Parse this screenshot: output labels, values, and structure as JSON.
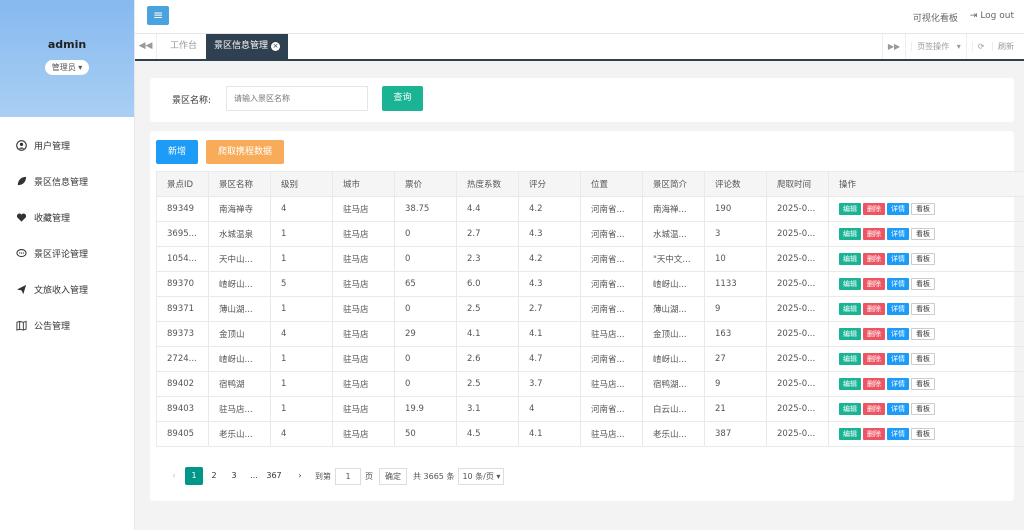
{
  "sidebar": {
    "username": "admin",
    "role": "管理员",
    "items": [
      {
        "icon": "user-icon",
        "label": "用户管理"
      },
      {
        "icon": "leaf-icon",
        "label": "景区信息管理"
      },
      {
        "icon": "heart-icon",
        "label": "收藏管理"
      },
      {
        "icon": "comment-icon",
        "label": "景区评论管理"
      },
      {
        "icon": "paper-plane-icon",
        "label": "文旅收入管理"
      },
      {
        "icon": "map-icon",
        "label": "公告管理"
      }
    ]
  },
  "topbar": {
    "dashboard_link": "可视化看板",
    "logout": "Log out"
  },
  "tabs": {
    "items": [
      {
        "label": "工作台"
      },
      {
        "label": "景区信息管理"
      }
    ],
    "page_ops": "页签操作",
    "refresh": "刷新"
  },
  "search": {
    "label": "景区名称:",
    "placeholder": "请输入景区名称",
    "button": "查询"
  },
  "actions": {
    "add": "新增",
    "crawl": "爬取携程数据"
  },
  "table": {
    "headers": [
      "景点ID",
      "景区名称",
      "级别",
      "城市",
      "票价",
      "热度系数",
      "评分",
      "位置",
      "景区简介",
      "评论数",
      "爬取时间",
      "操作"
    ],
    "op_labels": {
      "edit": "编辑",
      "del": "删除",
      "detail": "详情",
      "board": "看板"
    },
    "rows": [
      [
        "89349",
        "南海禅寺",
        "4",
        "驻马店",
        "38.75",
        "4.4",
        "4.2",
        "河南省...",
        "南海禅...",
        "190",
        "2025-0..."
      ],
      [
        "3695...",
        "水城温泉",
        "1",
        "驻马店",
        "0",
        "2.7",
        "4.3",
        "河南省...",
        "水城温...",
        "3",
        "2025-0..."
      ],
      [
        "1054...",
        "天中山...",
        "1",
        "驻马店",
        "0",
        "2.3",
        "4.2",
        "河南省...",
        "\"天中文...",
        "10",
        "2025-0..."
      ],
      [
        "89370",
        "嵖岈山...",
        "5",
        "驻马店",
        "65",
        "6.0",
        "4.3",
        "河南省...",
        "嵖岈山...",
        "1133",
        "2025-0..."
      ],
      [
        "89371",
        "薄山湖...",
        "1",
        "驻马店",
        "0",
        "2.5",
        "2.7",
        "河南省...",
        "薄山湖...",
        "9",
        "2025-0..."
      ],
      [
        "89373",
        "金顶山",
        "4",
        "驻马店",
        "29",
        "4.1",
        "4.1",
        "驻马店...",
        "金顶山...",
        "163",
        "2025-0..."
      ],
      [
        "2724...",
        "嵖岈山...",
        "1",
        "驻马店",
        "0",
        "2.6",
        "4.7",
        "河南省...",
        "嵖岈山...",
        "27",
        "2025-0..."
      ],
      [
        "89402",
        "宿鸭湖",
        "1",
        "驻马店",
        "0",
        "2.5",
        "3.7",
        "驻马店...",
        "宿鸭湖...",
        "9",
        "2025-0..."
      ],
      [
        "89403",
        "驻马店...",
        "1",
        "驻马店",
        "19.9",
        "3.1",
        "4",
        "河南省...",
        "白云山...",
        "21",
        "2025-0..."
      ],
      [
        "89405",
        "老乐山...",
        "4",
        "驻马店",
        "50",
        "4.5",
        "4.1",
        "驻马店...",
        "老乐山...",
        "387",
        "2025-0..."
      ]
    ]
  },
  "pagination": {
    "prev": "‹",
    "pages": [
      "1",
      "2",
      "3",
      "...",
      "367"
    ],
    "next": "›",
    "goto_label": "到第",
    "goto_value": "1",
    "page_unit": "页",
    "confirm": "确定",
    "total": "共 3665 条",
    "page_size": "10 条/页"
  },
  "colors": {
    "accent_green": "#1ab394",
    "accent_blue": "#1c9cf7",
    "accent_orange": "#f8ac59",
    "danger_red": "#ed5565",
    "tab_dark": "#2f4050"
  }
}
